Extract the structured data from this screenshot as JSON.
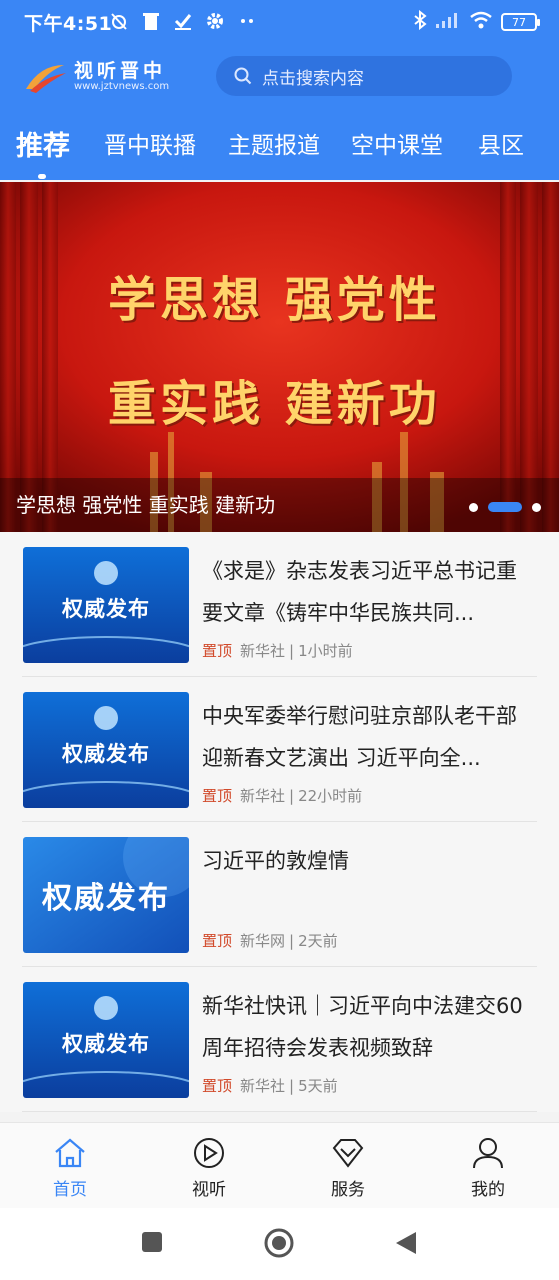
{
  "status_bar": {
    "time": "下午4:51",
    "battery": "77"
  },
  "brand": {
    "name": "视听晋中",
    "url": "www.jztvnews.com"
  },
  "search": {
    "placeholder": "点击搜索内容"
  },
  "tabs": [
    {
      "label": "推荐",
      "active": true
    },
    {
      "label": "晋中联播",
      "active": false
    },
    {
      "label": "主题报道",
      "active": false
    },
    {
      "label": "空中课堂",
      "active": false
    },
    {
      "label": "县区",
      "active": false
    }
  ],
  "banner": {
    "line1": "学思想 强党性",
    "line2": "重实践 建新功",
    "caption": "学思想 强党性 重实践 建新功",
    "slide_count": 3,
    "active_slide": 2
  },
  "news": [
    {
      "thumb_text": "权威发布",
      "title": "《求是》杂志发表习近平总书记重要文章《铸牢中华民族共同...",
      "pin": "置顶",
      "source": "新华社",
      "time": "1小时前"
    },
    {
      "thumb_text": "权威发布",
      "title": "中央军委举行慰问驻京部队老干部迎新春文艺演出 习近平向全...",
      "pin": "置顶",
      "source": "新华社",
      "time": "22小时前"
    },
    {
      "thumb_text": "权威发布",
      "title": "习近平的敦煌情",
      "pin": "置顶",
      "source": "新华网",
      "time": "2天前"
    },
    {
      "thumb_text": "权威发布",
      "title": "新华社快讯｜习近平向中法建交60周年招待会发表视频致辞",
      "pin": "置顶",
      "source": "新华社",
      "time": "5天前"
    }
  ],
  "bottom_nav": [
    {
      "label": "首页",
      "icon": "home-icon",
      "active": true
    },
    {
      "label": "视听",
      "icon": "play-circle-icon",
      "active": false
    },
    {
      "label": "服务",
      "icon": "diamond-icon",
      "active": false
    },
    {
      "label": "我的",
      "icon": "user-icon",
      "active": false
    }
  ],
  "separator": "|",
  "colors": {
    "primary": "#3a86f5",
    "pin": "#d14a2b",
    "banner_red": "#c8170f",
    "banner_gold": "#ffd46a"
  }
}
